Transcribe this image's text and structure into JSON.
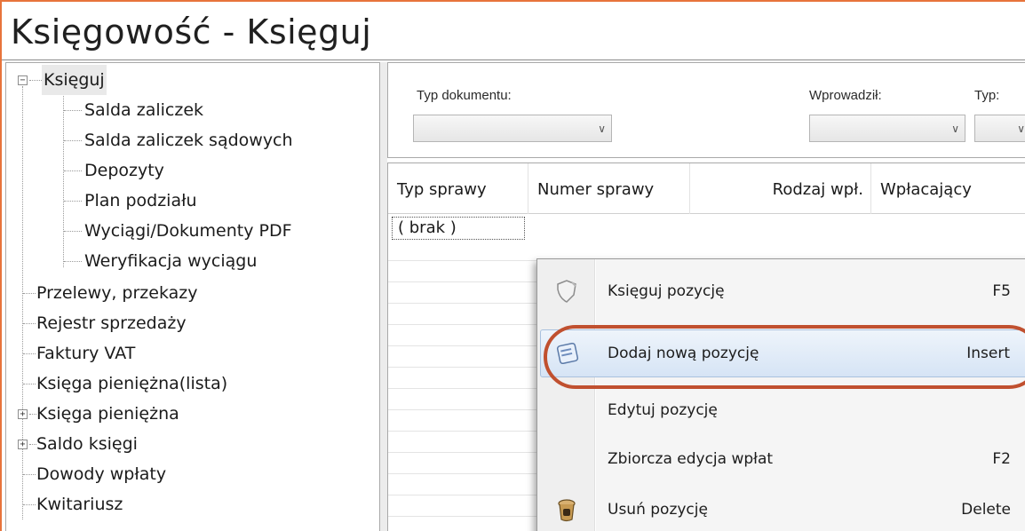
{
  "window": {
    "title": "Księgowość - Księguj",
    "accent_color": "#e8743b"
  },
  "tree": {
    "root": {
      "label": "Księguj",
      "expander": "−"
    },
    "children": [
      "Salda zaliczek",
      "Salda zaliczek sądowych",
      "Depozyty",
      "Plan podziału",
      "Wyciągi/Dokumenty PDF",
      "Weryfikacja wyciągu"
    ],
    "items": [
      {
        "label": "Przelewy, przekazy"
      },
      {
        "label": "Rejestr sprzedaży"
      },
      {
        "label": "Faktury VAT"
      },
      {
        "label": "Księga pieniężna(lista)"
      },
      {
        "label": "Księga pieniężna",
        "expander": "+"
      },
      {
        "label": "Saldo księgi",
        "expander": "+"
      },
      {
        "label": "Dowody wpłaty"
      },
      {
        "label": "Kwitariusz"
      }
    ]
  },
  "filters": {
    "typ_dokumentu": {
      "label": "Typ dokumentu:",
      "value": ""
    },
    "wprowadzil": {
      "label": "Wprowadził:",
      "value": ""
    },
    "typ": {
      "label": "Typ:",
      "value": ""
    }
  },
  "grid": {
    "columns": [
      "Typ sprawy",
      "Numer sprawy",
      "Rodzaj wpł.",
      "Wpłacający"
    ],
    "rows": [
      [
        "( brak )",
        "",
        "",
        ""
      ]
    ]
  },
  "context_menu": {
    "items": [
      {
        "label": "Księguj pozycję",
        "shortcut": "F5",
        "icon": "shield-icon"
      },
      {
        "label": "Dodaj nową pozycję",
        "shortcut": "Insert",
        "icon": "add-document-icon",
        "highlighted": true
      },
      {
        "label": "Edytuj pozycję",
        "shortcut": "",
        "icon": ""
      },
      {
        "label": "Zbiorcza edycja wpłat",
        "shortcut": "F2",
        "icon": ""
      },
      {
        "label": "Usuń pozycję",
        "shortcut": "Delete",
        "icon": "trash-icon"
      }
    ],
    "highlight_color": "#c0502f"
  }
}
